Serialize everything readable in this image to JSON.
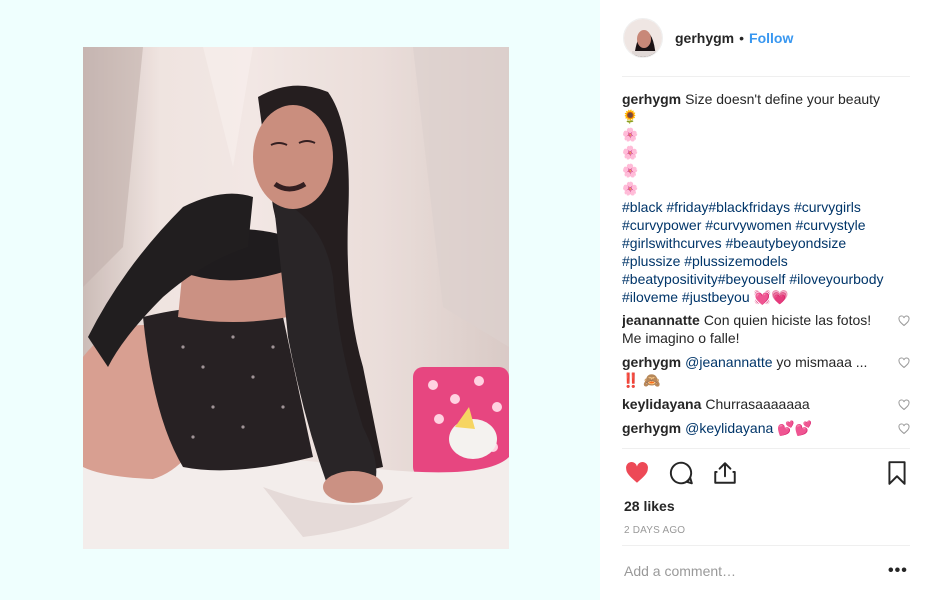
{
  "post": {
    "username": "gerhygm",
    "follow_label": "Follow",
    "dot": "•",
    "caption": {
      "username": "gerhygm",
      "text": "Size doesn't define your beauty",
      "emoji_lines": [
        "🌻",
        "🌸",
        "🌸",
        "🌸",
        "🌸"
      ],
      "hashtag_lines": [
        "#black #friday#blackfridays #curvygirls",
        "#curvypower #curvywomen #curvystyle",
        "#girlswithcurves #beautybeyondsize",
        "#plussize #plussizemodels",
        "#beatypositivity#beyouself #iloveyourbody",
        "#iloveme #justbeyou 💓💗"
      ]
    },
    "comments": [
      {
        "username": "jeanannatte",
        "text": "Con quien hiciste las fotos! Me imagino o falle!"
      },
      {
        "username": "gerhygm",
        "mention": "@jeanannatte",
        "text": " yo mismaaa ... ‼️ 🙈"
      },
      {
        "username": "keylidayana",
        "text": "Churrasaaaaaaa"
      },
      {
        "username": "gerhygm",
        "mention": "@keylidayana",
        "text": " 💕💕"
      }
    ],
    "likes": "28 likes",
    "time": "2 DAYS AGO",
    "add_comment_placeholder": "Add a comment…",
    "more_label": "•••"
  },
  "colors": {
    "link": "#3897f0",
    "heart": "#ed4956",
    "hashtag": "#003569",
    "media_bg": "#effffe"
  },
  "icons": [
    "heart-icon",
    "comment-icon",
    "share-icon",
    "bookmark-icon",
    "small-heart-icon"
  ]
}
